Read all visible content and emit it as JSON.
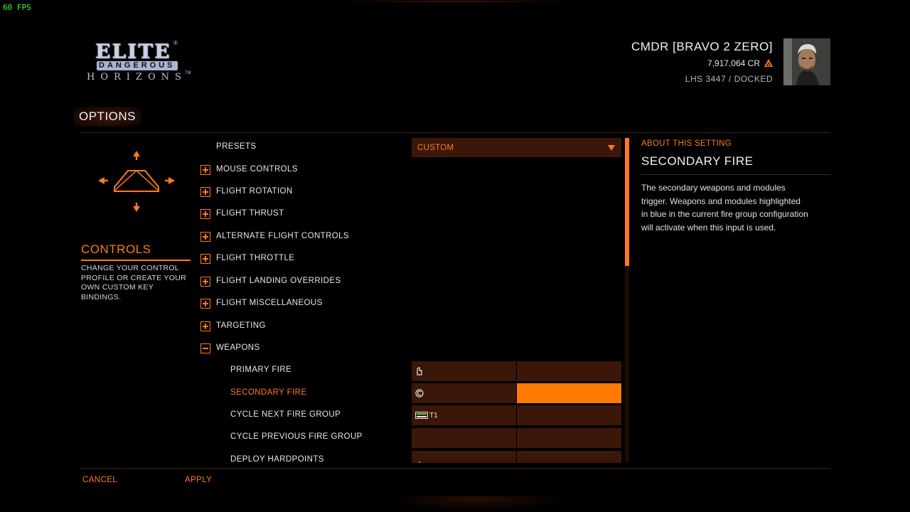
{
  "hud": {
    "fps": "60 FPS"
  },
  "logo": {
    "line1": "ELITE",
    "line2": "DANGEROUS",
    "line3": "HORIZONS"
  },
  "commander": {
    "name": "CMDR [BRAVO 2 ZERO]",
    "credits": "7,917,064 CR",
    "location": "LHS 3447 / DOCKED"
  },
  "page": {
    "title": "OPTIONS"
  },
  "sidebar": {
    "title": "CONTROLS",
    "description": "CHANGE YOUR CONTROL PROFILE OR CREATE YOUR OWN CUSTOM KEY BINDINGS."
  },
  "presets": {
    "label": "PRESETS",
    "value": "CUSTOM"
  },
  "categories": [
    {
      "label": "MOUSE CONTROLS",
      "expanded": false
    },
    {
      "label": "FLIGHT ROTATION",
      "expanded": false
    },
    {
      "label": "FLIGHT THRUST",
      "expanded": false
    },
    {
      "label": "ALTERNATE FLIGHT CONTROLS",
      "expanded": false
    },
    {
      "label": "FLIGHT THROTTLE",
      "expanded": false
    },
    {
      "label": "FLIGHT LANDING OVERRIDES",
      "expanded": false
    },
    {
      "label": "FLIGHT MISCELLANEOUS",
      "expanded": false
    },
    {
      "label": "TARGETING",
      "expanded": false
    },
    {
      "label": "WEAPONS",
      "expanded": true
    }
  ],
  "bindings": [
    {
      "label": "PRIMARY FIRE",
      "primary_icon": "mouse-left-icon"
    },
    {
      "label": "SECONDARY FIRE",
      "primary_icon": "mouse-right-icon",
      "selected": true
    },
    {
      "label": "CYCLE NEXT FIRE GROUP",
      "primary_icon": "keyboard-icon",
      "primary_text": "T1"
    },
    {
      "label": "CYCLE PREVIOUS FIRE GROUP",
      "primary_icon": ""
    },
    {
      "label": "DEPLOY HARDPOINTS",
      "primary_icon": "mouse-move-icon"
    }
  ],
  "about": {
    "label": "ABOUT THIS SETTING",
    "title": "SECONDARY FIRE",
    "description": "The secondary weapons and modules trigger. Weapons and modules highlighted in blue in the current fire group configuration will activate when this input is used."
  },
  "footer": {
    "cancel": "CANCEL",
    "apply": "APPLY"
  },
  "colors": {
    "accent": "#ff7a1a",
    "cell_bg": "#3a1708",
    "selected_cell": "#ff7a00",
    "fps": "#3cff2e"
  }
}
